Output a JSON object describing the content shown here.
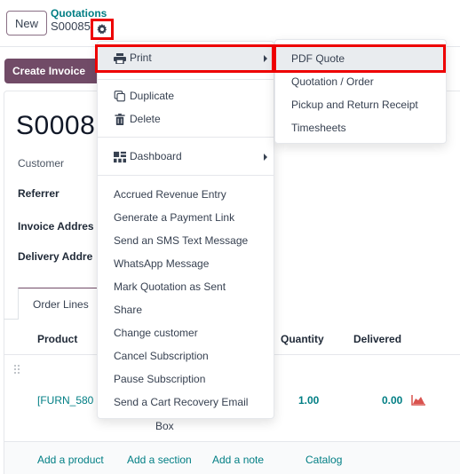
{
  "control_panel": {
    "new_label": "New",
    "breadcrumb_parent": "Quotations",
    "breadcrumb_current": "S00085",
    "gear_icon": "gear-icon",
    "create_invoice_label": "Create Invoice"
  },
  "form": {
    "title": "S0008",
    "fields": [
      {
        "label": "Customer"
      },
      {
        "label": "Referrer"
      },
      {
        "label": "Invoice Addres"
      },
      {
        "label": "Delivery Addre"
      }
    ],
    "tabs": [
      {
        "label": "Order Lines",
        "active": true
      }
    ],
    "table": {
      "headers": [
        "Product",
        "Quantity",
        "Delivered"
      ],
      "rows": [
        {
          "product": "[FURN_580",
          "uom": "Box",
          "quantity": "1.00",
          "delivered": "0.00",
          "forecast_icon": "area-chart-icon"
        }
      ]
    },
    "footer_links": [
      "Add a product",
      "Add a section",
      "Add a note",
      "Catalog"
    ]
  },
  "action_menu": {
    "items": [
      {
        "label": "Print",
        "icon": "printer-icon",
        "submenu": true,
        "highlighted": true
      },
      {
        "label": "Duplicate",
        "icon": "copy-icon"
      },
      {
        "label": "Delete",
        "icon": "trash-icon"
      },
      {
        "label": "Dashboard",
        "icon": "dashboard-icon",
        "submenu": true
      },
      {
        "label": "Accrued Revenue Entry"
      },
      {
        "label": "Generate a Payment Link"
      },
      {
        "label": "Send an SMS Text Message"
      },
      {
        "label": "WhatsApp Message"
      },
      {
        "label": "Mark Quotation as Sent"
      },
      {
        "label": "Share"
      },
      {
        "label": "Change customer"
      },
      {
        "label": "Cancel Subscription"
      },
      {
        "label": "Pause Subscription"
      },
      {
        "label": "Send a Cart Recovery Email"
      }
    ]
  },
  "print_submenu": {
    "items": [
      {
        "label": "PDF Quote",
        "highlighted": true
      },
      {
        "label": "Quotation / Order"
      },
      {
        "label": "Pickup and Return Receipt"
      },
      {
        "label": "Timesheets"
      }
    ]
  },
  "colors": {
    "brand": "#714b67",
    "link": "#017e84",
    "highlight_box": "#ee0000",
    "forecast_icon": "#d9534f"
  }
}
